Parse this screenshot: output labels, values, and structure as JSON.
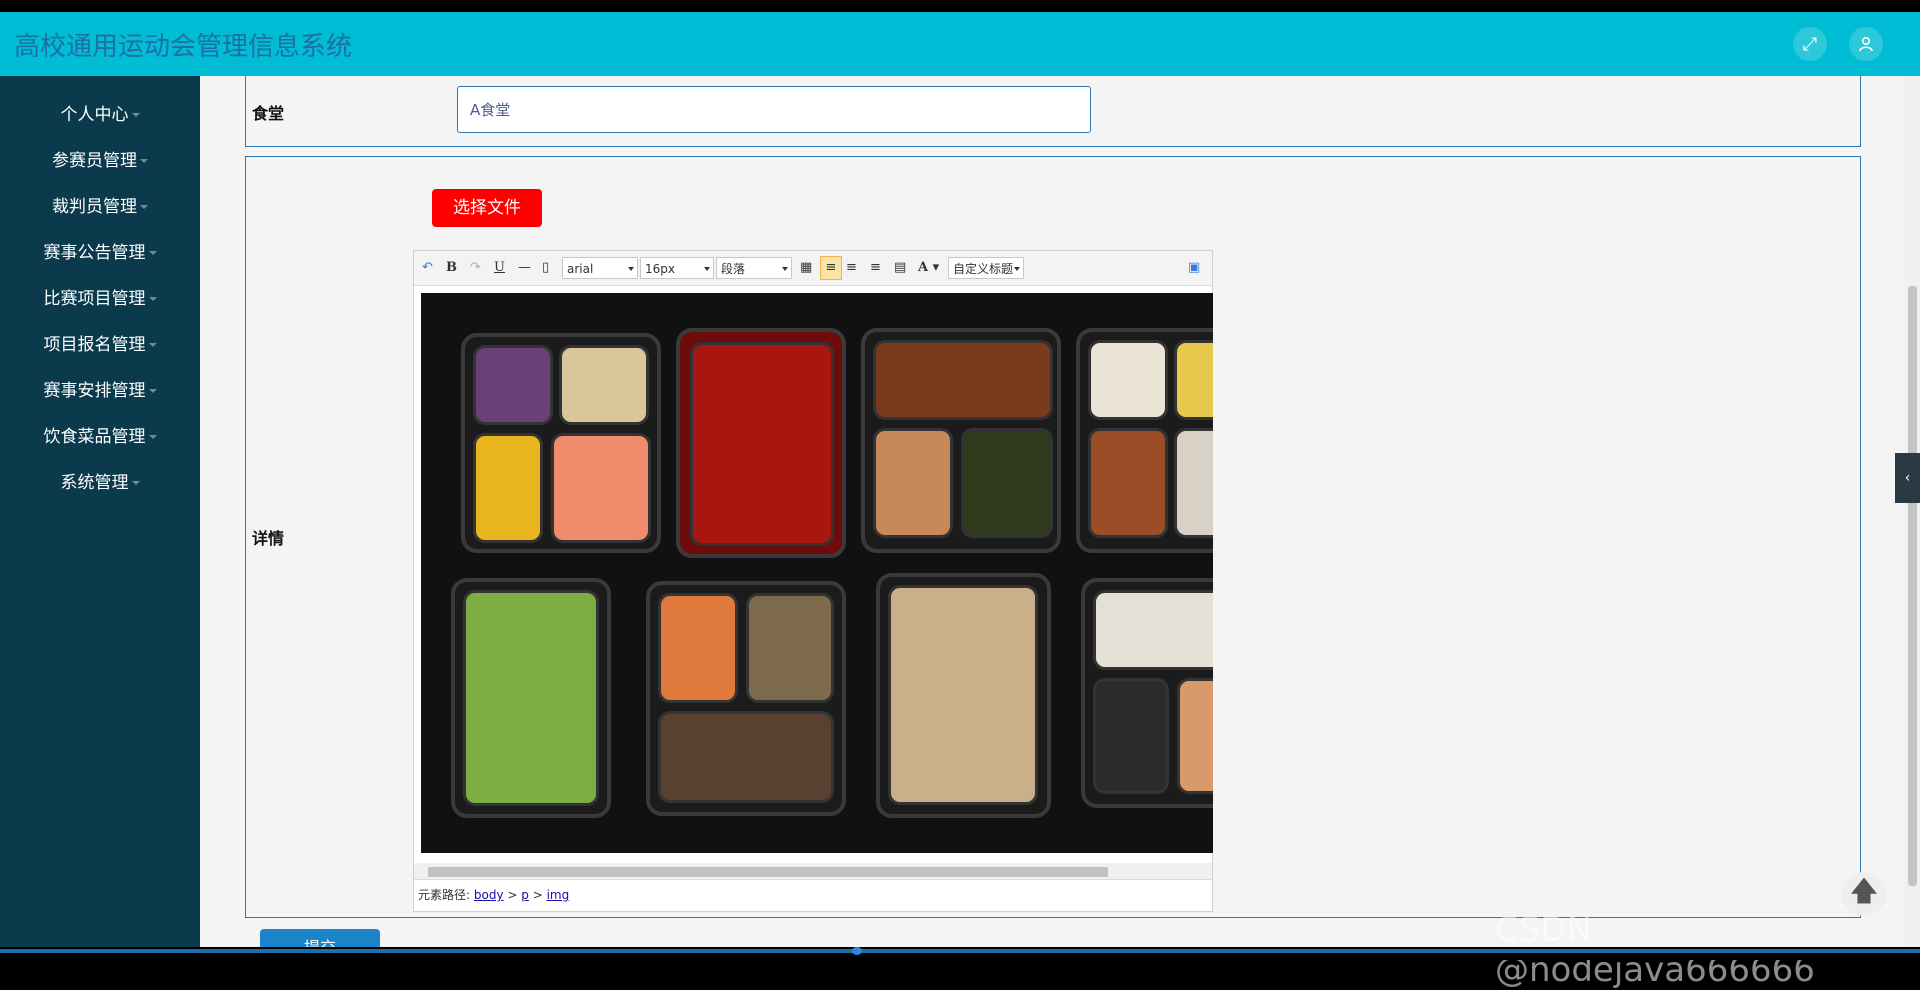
{
  "header": {
    "title": "高校通用运动会管理信息系统"
  },
  "sidebar": {
    "items": [
      {
        "label": "个人中心"
      },
      {
        "label": "参赛员管理"
      },
      {
        "label": "裁判员管理"
      },
      {
        "label": "赛事公告管理"
      },
      {
        "label": "比赛项目管理"
      },
      {
        "label": "项目报名管理"
      },
      {
        "label": "赛事安排管理"
      },
      {
        "label": "饮食菜品管理"
      },
      {
        "label": "系统管理"
      }
    ]
  },
  "form": {
    "canteen_label": "食堂",
    "canteen_value": "A食堂",
    "detail_label": "详情",
    "upload_label": "选择文件",
    "submit_label": "提交"
  },
  "editor": {
    "font_family": "arial",
    "font_size": "16px",
    "paragraph": "段落",
    "custom_title": "自定义标题",
    "path_label": "元素路径:",
    "path": [
      "body",
      "p",
      "img"
    ]
  },
  "watermark": "CSDN @nodejava666666",
  "colors": {
    "header": "#00bcd4",
    "sidebar": "#0b3a4c",
    "upload_button": "#ff0000",
    "accent": "#2d76b0"
  }
}
